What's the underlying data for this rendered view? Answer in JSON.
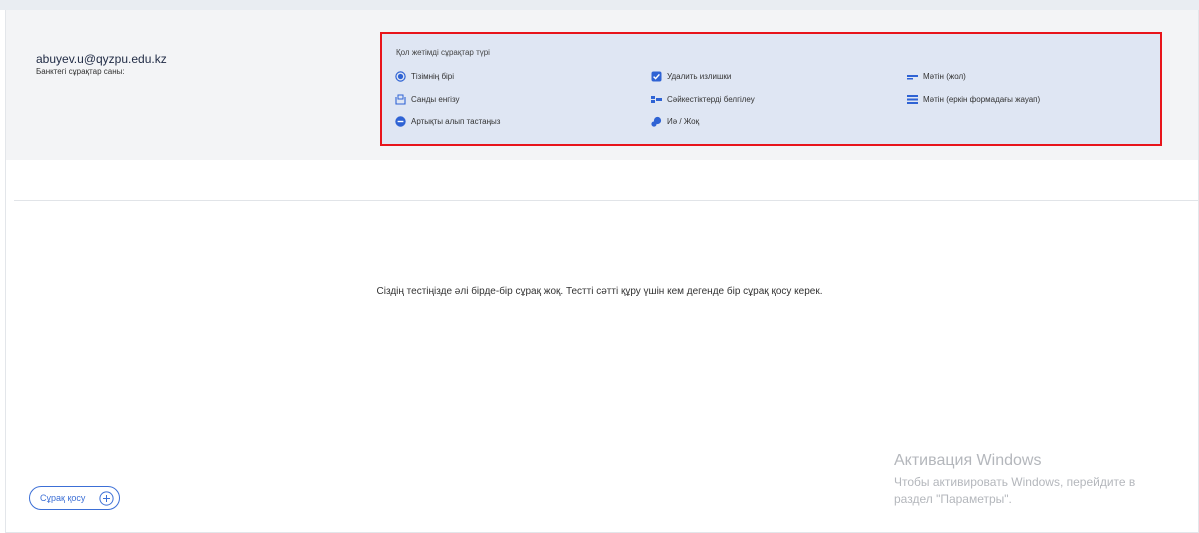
{
  "header": {
    "email": "abuyev.u@qyzpu.edu.kz",
    "bank_count_label": "Банктегі сұрақтар саны:"
  },
  "question_types": {
    "title": "Қол жетімді сұрақтар түрі",
    "items": [
      {
        "label": "Тізімнің бірі",
        "icon": "radio-icon"
      },
      {
        "label": "Удалить излишки",
        "icon": "checkbox-icon"
      },
      {
        "label": "Мәтін (жол)",
        "icon": "text-line-icon"
      },
      {
        "label": "Санды енгізу",
        "icon": "number-input-icon"
      },
      {
        "label": "Сәйкестіктерді белгілеу",
        "icon": "matching-icon"
      },
      {
        "label": "Мәтін (еркін формадағы жауап)",
        "icon": "text-paragraph-icon"
      },
      {
        "label": "Артықты алып тастаңыз",
        "icon": "minus-circle-icon"
      },
      {
        "label": "Иә / Жоқ",
        "icon": "yes-no-icon"
      }
    ]
  },
  "main": {
    "empty_message": "Сіздің тестіңізде әлі бірде-бір сұрақ жоқ. Тестті сәтті құру үшін кем дегенде бір сұрақ қосу керек."
  },
  "footer": {
    "add_question_label": "Сұрақ қосу"
  },
  "watermark": {
    "title": "Активация Windows",
    "line1": "Чтобы активировать Windows, перейдите в",
    "line2": "раздел \"Параметры\"."
  },
  "colors": {
    "accent": "#3c6fd6",
    "highlight_border": "#e8141b",
    "types_bg": "#dfe6f3"
  }
}
